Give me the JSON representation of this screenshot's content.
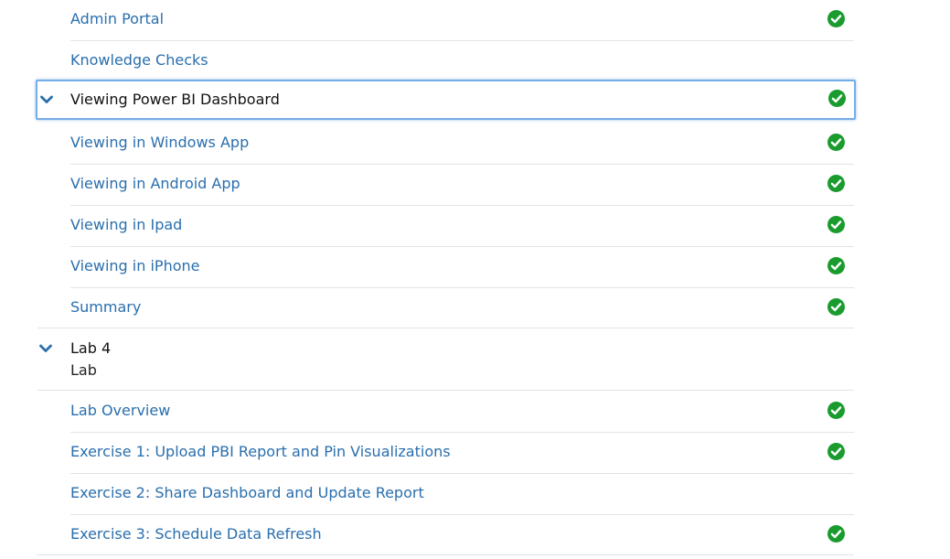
{
  "colors": {
    "link": "#2a6fad",
    "complete": "#1a9b2e",
    "focus_border": "#76aee6",
    "divider": "#e3e3e3"
  },
  "items_before": [
    {
      "label": "Admin Portal",
      "completed": true,
      "icon": "check-circle-icon"
    },
    {
      "label": "Knowledge Checks",
      "completed": false
    }
  ],
  "section": {
    "label": "Viewing Power BI Dashboard",
    "expanded": true,
    "completed": true,
    "focused": true,
    "toggle_icon": "chevron-down-icon"
  },
  "section_items": [
    {
      "label": "Viewing in Windows App",
      "completed": true
    },
    {
      "label": "Viewing in Android App",
      "completed": true
    },
    {
      "label": "Viewing in Ipad",
      "completed": true
    },
    {
      "label": "Viewing in iPhone",
      "completed": true
    },
    {
      "label": "Summary",
      "completed": true
    }
  ],
  "lab": {
    "title": "Lab 4",
    "subtitle": "Lab",
    "expanded": true,
    "toggle_icon": "chevron-down-icon"
  },
  "lab_items": [
    {
      "label": "Lab Overview",
      "completed": true
    },
    {
      "label": "Exercise 1: Upload PBI Report and Pin Visualizations",
      "completed": true
    },
    {
      "label": "Exercise 2: Share Dashboard and Update Report",
      "completed": false
    },
    {
      "label": "Exercise 3: Schedule Data Refresh",
      "completed": true
    }
  ]
}
